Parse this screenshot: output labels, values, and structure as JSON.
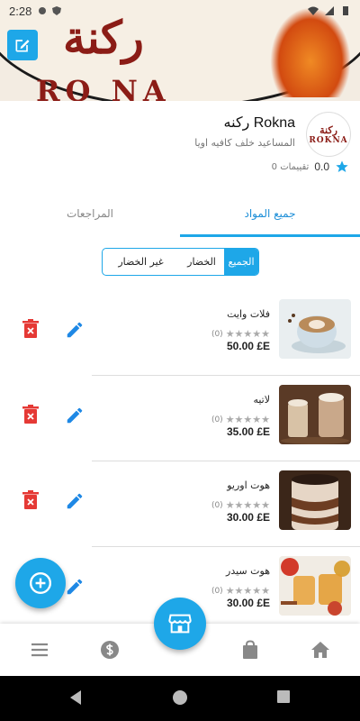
{
  "status_bar": {
    "time": "2:28"
  },
  "cover": {
    "arabic_logo": "ركنة",
    "latin_logo": "RO NA",
    "edit_icon": "edit-icon"
  },
  "store": {
    "name": "Rokna ركنه",
    "address": "المساعيد خلف كافيه اويا",
    "rating_value": "0.0",
    "ratings_count": "0 تقييمات",
    "logo_line1": "ركنة",
    "logo_line2": "ROKNA"
  },
  "tabs": {
    "all_items": "جميع المواد",
    "reviews": "المراجعات"
  },
  "filter": {
    "all": "الجميع",
    "vegetables": "الخضار",
    "non_vegetables": "غير الخضار"
  },
  "products": [
    {
      "name": "فلات وايت",
      "rating_count": "(0)",
      "price": "50.00 £E",
      "stars": 0
    },
    {
      "name": "لاتيه",
      "rating_count": "(0)",
      "price": "35.00 £E",
      "stars": 0
    },
    {
      "name": "هوت اوريو",
      "rating_count": "(0)",
      "price": "30.00 £E",
      "stars": 0
    },
    {
      "name": "هوت سيدر",
      "rating_count": "(0)",
      "price": "30.00 £E",
      "stars": 0
    }
  ],
  "bottom_nav": [
    "menu-icon",
    "dollar-icon",
    "bag-icon",
    "home-icon"
  ],
  "colors": {
    "accent": "#1ea7e8",
    "delete": "#e53935",
    "brand": "#8b1c16"
  }
}
